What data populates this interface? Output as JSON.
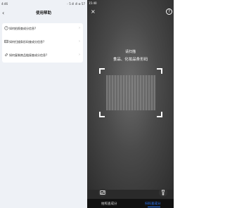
{
  "left": {
    "status": {
      "time": "4:46",
      "icons": "◦ 5 ıll ıll ⊕ 57"
    },
    "header": {
      "back": "‹",
      "title": "使用帮助"
    },
    "faq": [
      {
        "label": "如何拍照查成分信息?"
      },
      {
        "label": "如何扫描条形码查成分信息?"
      },
      {
        "label": "如何复制商品链接查成分信息?"
      }
    ]
  },
  "right": {
    "status": {
      "time": "15:40"
    },
    "scan_title": "请扫描",
    "scan_subtitle": "食品、化妆品条形码",
    "close": "×",
    "help": "?",
    "tabs": [
      "拍照查成分",
      "扫码查成分"
    ],
    "active_tab": 1,
    "accent": "#2e7bff"
  }
}
